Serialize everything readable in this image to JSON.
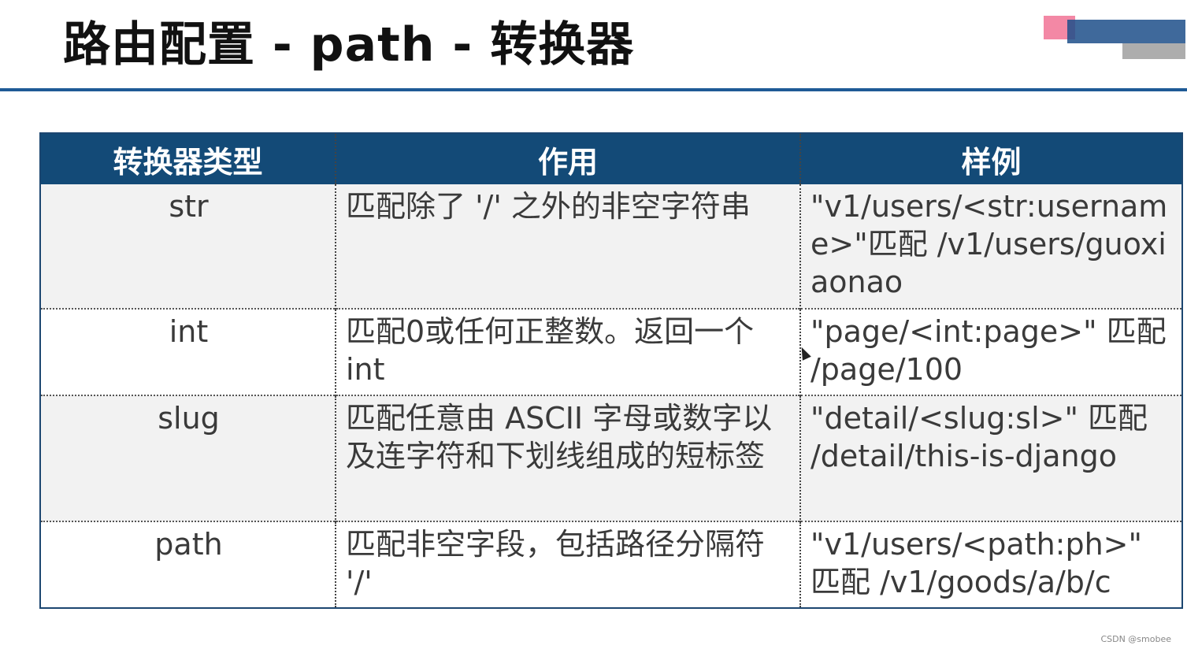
{
  "title": "路由配置 - path - 转换器",
  "table": {
    "headers": [
      "转换器类型",
      "作用",
      "样例"
    ],
    "rows": [
      {
        "type": "str",
        "desc": "匹配除了 '/' 之外的非空字符串",
        "example": "\"v1/users/<str:username>\"匹配 /v1/users/guoxiaonao"
      },
      {
        "type": "int",
        "desc": "匹配0或任何正整数。返回一个int",
        "example": "\"page/<int:page>\" 匹配 /page/100"
      },
      {
        "type": "slug",
        "desc": "匹配任意由 ASCII 字母或数字以及连字符和下划线组成的短标签",
        "example": "\"detail/<slug:sl>\" 匹配 /detail/this-is-django"
      },
      {
        "type": "path",
        "desc": "匹配非空字段，包括路径分隔符 '/'",
        "example": "\"v1/users/<path:ph>\" 匹配 /v1/goods/a/b/c"
      }
    ]
  },
  "watermark": "CSDN @smobee",
  "colors": {
    "header_bg": "#134a77",
    "rule": "#1e5a96"
  }
}
